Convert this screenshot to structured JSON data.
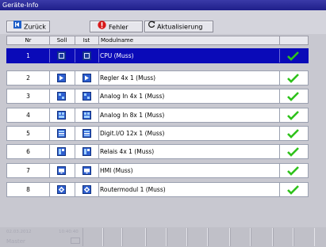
{
  "window": {
    "title": "Geräte-Info"
  },
  "toolbar": {
    "back_label": "Zurück",
    "error_label": "Fehler",
    "refresh_label": "Aktualisierung"
  },
  "table": {
    "headers": {
      "nr": "Nr",
      "soll": "Soll",
      "ist": "Ist",
      "module": "Modulname",
      "status": ""
    },
    "rows": [
      {
        "nr": "1",
        "module": "CPU (Muss)",
        "selected": true
      },
      {
        "nr": "2",
        "module": "Regler 4x 1 (Muss)",
        "selected": false
      },
      {
        "nr": "3",
        "module": "Analog In 4x 1 (Muss)",
        "selected": false
      },
      {
        "nr": "4",
        "module": "Analog In 8x 1 (Muss)",
        "selected": false
      },
      {
        "nr": "5",
        "module": "Digit.I/O 12x 1 (Muss)",
        "selected": false
      },
      {
        "nr": "6",
        "module": "Relais 4x 1 (Muss)",
        "selected": false
      },
      {
        "nr": "7",
        "module": "HMI (Muss)",
        "selected": false
      },
      {
        "nr": "8",
        "module": "Routermodul 1 (Muss)",
        "selected": false
      }
    ]
  },
  "statusbar": {
    "date": "02.03.2012",
    "time": "10:40:40",
    "user": "Master"
  },
  "colors": {
    "title_bg": "#1f1f8a",
    "selection": "#0a0ab8",
    "check": "#2ec21a",
    "error": "#d81818"
  }
}
